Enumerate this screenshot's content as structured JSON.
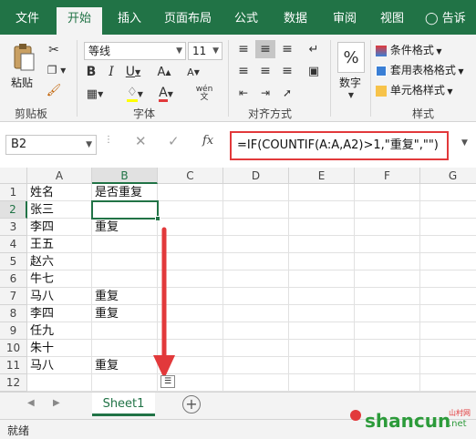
{
  "tabs": [
    {
      "label": "文件",
      "active": false
    },
    {
      "label": "开始",
      "active": true
    },
    {
      "label": "插入",
      "active": false
    },
    {
      "label": "页面布局",
      "active": false
    },
    {
      "label": "公式",
      "active": false
    },
    {
      "label": "数据",
      "active": false
    },
    {
      "label": "审阅",
      "active": false
    },
    {
      "label": "视图",
      "active": false
    }
  ],
  "help": {
    "label": "告诉我"
  },
  "ribbon": {
    "clipboard": {
      "paste_label": "粘贴",
      "group_label": "剪贴板"
    },
    "font": {
      "font_name": "等线",
      "font_size": "11",
      "group_label": "字体",
      "wen_label": "wén"
    },
    "alignment": {
      "group_label": "对齐方式"
    },
    "number": {
      "label": "数字",
      "percent": "%"
    },
    "styles": {
      "conditional_format": "条件格式",
      "table_format": "套用表格格式",
      "cell_styles": "单元格样式",
      "group_label": "样式"
    }
  },
  "formula_bar": {
    "name_box": "B2",
    "fx": "fx",
    "formula": "=IF(COUNTIF(A:A,A2)>1,\"重复\",\"\")"
  },
  "columns": [
    "A",
    "B",
    "C",
    "D",
    "E",
    "F",
    "G"
  ],
  "rows": [
    "1",
    "2",
    "3",
    "4",
    "5",
    "6",
    "7",
    "8",
    "9",
    "10",
    "11",
    "12"
  ],
  "cells": {
    "a": [
      "姓名",
      "张三",
      "李四",
      "王五",
      "赵六",
      "牛七",
      "马八",
      "李四",
      "任九",
      "朱十",
      "马八",
      ""
    ],
    "b": [
      "是否重复",
      "",
      "重复",
      "",
      "",
      "",
      "重复",
      "重复",
      "",
      "",
      "重复",
      ""
    ]
  },
  "sheet": {
    "name": "Sheet1",
    "add": "+"
  },
  "status": {
    "text": "就绪"
  },
  "watermark": {
    "text": "shancun",
    "tld": ".net",
    "small": "山村网"
  },
  "accent": "#217346",
  "highlight": "#e2393b"
}
